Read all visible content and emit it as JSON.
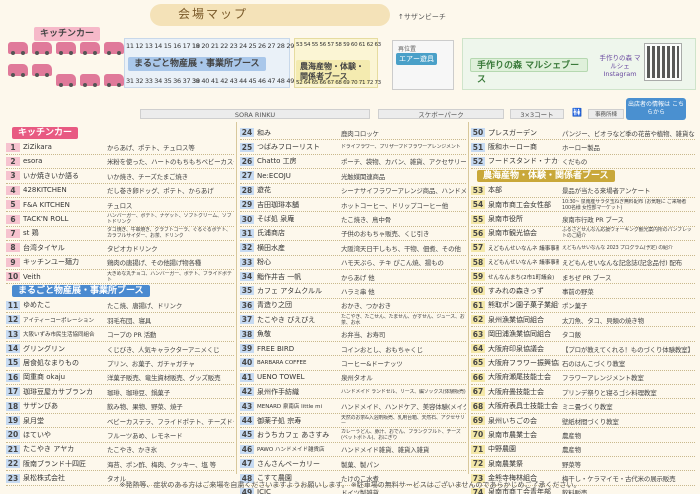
{
  "map": {
    "title": "会場マップ",
    "sunbeach": "↑サザンビーチ",
    "kitchen_banner": "キッチンカー",
    "marugoto_banner": "まるごと物産展・事業所ブース",
    "nogyo_banner": "農海産物・体験・関係者ブース",
    "tezukuri_banner": "手作りの森 マルシェブース",
    "play_label": "再位置",
    "play_air": "エアー遊具",
    "instagram": "手作りの森 マルシェ Instagram",
    "info_bubble": "出店者の情報は こちらから",
    "road_sora": "SORA RINKU",
    "road_skate": "スケボーパーク",
    "road_3x3": "3×3コート",
    "road_office": "事務所棟",
    "numrow_top_left": "11 12 13 14 15 16 17 18",
    "numrow_top_mid": "19 20 21 22 23 24 25 26 27 28 29 30",
    "numrow_bot_left": "31 32 33 34 35 36 37 38",
    "numrow_bot_mid": "39 40 41 42 43 44 45 46 47 48 49 50 51",
    "numrow_top_right": "53 54 55 56 57 58 59 60 61 62 63",
    "numrow_bot_right": "52 64 65 66 67 68 69 70 71 72 73"
  },
  "sections": {
    "kitchen": "キッチンカー",
    "marugoto": "まるごと物産展・事業所ブース",
    "nogyo": "農海産物・体験・関係者ブース"
  },
  "col1": [
    {
      "n": "1",
      "name": "ZiZikara",
      "desc": "からあげ、ポテト、チュロス等"
    },
    {
      "n": "2",
      "name": "esora",
      "desc": "米粉を使った、ハートのもちもちベビーカステラ"
    },
    {
      "n": "3",
      "name": "いか焼きいか語る",
      "desc": "いか焼き、チーズたまご焼き"
    },
    {
      "n": "4",
      "name": "428KITCHEN",
      "desc": "だし巻き卵ドッグ、ポテト、からあげ"
    },
    {
      "n": "5",
      "name": "F&A KITCHEN",
      "desc": "チュロス"
    },
    {
      "n": "6",
      "name": "TACK'N ROLL",
      "desc": "ハンバーガー、ポテト、ナゲット、ソフトクリーム、ソフトドリンク"
    },
    {
      "n": "7",
      "name": "st 鶏",
      "desc": "タコ焼き、牛串焼き、クラフトコーラ、ぐるぐるポテト、カラフルサイダー、お茶、ドリンク"
    },
    {
      "n": "8",
      "name": "台湾タイヤル",
      "desc": "タピオカドリンク"
    },
    {
      "n": "9",
      "name": "キッチンユー麺力",
      "desc": "鶏肉の唐揚げ、その他揚げ物各種"
    },
    {
      "n": "10",
      "name": "Veith",
      "desc": "大きめな丸チョコ、ハンバーガー、ポテト、フライドポテト"
    },
    {
      "n": "11",
      "name": "ゆめたこ",
      "desc": "たこ焼、唐揚げ、ドリンク"
    },
    {
      "n": "12",
      "name": "アイティーコーポレーション",
      "desc": "羽毛布団、寝具"
    },
    {
      "n": "13",
      "name": "大阪いずみ市民生活協同組合",
      "desc": "コープの PR 活動"
    },
    {
      "n": "14",
      "name": "グリングリン",
      "desc": "くじびき、人気キャラクターアニメくじ"
    },
    {
      "n": "15",
      "name": "居食処なまりもの",
      "desc": "プリン、お菓子、ガチャガチャ"
    },
    {
      "n": "16",
      "name": "岡重商 okaju",
      "desc": "洋菓子販売、竜生資材販売、グッズ販売"
    },
    {
      "n": "17",
      "name": "珈琲豆屋カサブランカ",
      "desc": "珈琲、珈琲豆、鍋菓子"
    },
    {
      "n": "18",
      "name": "サザンびあ",
      "desc": "飲み物、果物、野菜、焼子"
    },
    {
      "n": "19",
      "name": "泉月堂",
      "desc": "ベビーカステラ、フライドポテト、チーズドッグ"
    },
    {
      "n": "20",
      "name": "ほていや",
      "desc": "フルーツあめ、レモネード"
    },
    {
      "n": "21",
      "name": "たこやき アヤカ",
      "desc": "たこやき、かき氷"
    },
    {
      "n": "22",
      "name": "阪南ブランド十四匠",
      "desc": "海苔、ポン酢、梅肉、クッキー、塩 等"
    },
    {
      "n": "23",
      "name": "泉松株式会社",
      "desc": "タオル"
    }
  ],
  "col2": [
    {
      "n": "24",
      "name": "和み",
      "desc": "鹿肉コロッケ"
    },
    {
      "n": "25",
      "name": "つばみフローリスト",
      "desc": "ドライフラワー、プリザーブドフラワーアレンジメント"
    },
    {
      "n": "26",
      "name": "Chatto 工房",
      "desc": "ポーチ、袋物、カバン、雑貨、アクセサリー"
    },
    {
      "n": "27",
      "name": "Ne:ECOJU",
      "desc": "光触媒関連商品"
    },
    {
      "n": "28",
      "name": "遊花",
      "desc": "シーナサイフラワーアレンジ商品、ハンドメイド雑貨"
    },
    {
      "n": "29",
      "name": "吉田珈琲本舗",
      "desc": "ホットコーヒー、ドリップコーヒー他"
    },
    {
      "n": "30",
      "name": "そば処 泉庵",
      "desc": "たこ焼き、鳥中骨"
    },
    {
      "n": "31",
      "name": "氏浦商店",
      "desc": "子供のおもちゃ販売、くじ引き"
    },
    {
      "n": "32",
      "name": "横田水産",
      "desc": "大阪湾天日干しもち、干物、佃煮、その他"
    },
    {
      "n": "33",
      "name": "粉心",
      "desc": "ハモ天ぷら、チキ ぴこん焼、揚もの"
    },
    {
      "n": "34",
      "name": "鮨作井吉 一帆",
      "desc": "からあげ 他"
    },
    {
      "n": "35",
      "name": "カフェ アタムクルル",
      "desc": "ハラミ串 他"
    },
    {
      "n": "36",
      "name": "青造り之団",
      "desc": "おかき、つかおき"
    },
    {
      "n": "37",
      "name": "たこやき ぴえぴえ",
      "desc": "たこやき、たこせん、たません、かすせん、ジュース、お茶、お水"
    },
    {
      "n": "38",
      "name": "魚敬",
      "desc": "お弁当、お寿司"
    },
    {
      "n": "39",
      "name": "FREE BIRD",
      "desc": "コインおとし、おもちゃくじ"
    },
    {
      "n": "40",
      "name": "BARBARA COFFEE",
      "desc": "コーヒー&ドーナッツ"
    },
    {
      "n": "41",
      "name": "UENO TOWEL",
      "desc": "泉州タオル"
    },
    {
      "n": "42",
      "name": "泉州作手紡織",
      "desc": "ハンドメイド ランドセル、リース、編ソックス(体験販売)"
    },
    {
      "n": "43",
      "name": "MENARD 泉南店 little mi",
      "desc": "ハンドメイド、ハンドケア、美容体験(メイク)"
    },
    {
      "n": "44",
      "name": "御薬子処 宗寿",
      "desc": "天然のお茶&入浴剤販売、乳用台箱、天然石、アクセサリー"
    },
    {
      "n": "45",
      "name": "おうちカフェ あさすみ",
      "desc": "カレーうどん、豚汁、おでん、フランクフルト、チーズ(ベットボトル)、おにぎり"
    },
    {
      "n": "46",
      "name": "PAWO ハンドメイド雑貨店",
      "desc": "ハンドメイド雑貨、雑貨入雑貨"
    },
    {
      "n": "47",
      "name": "さんさんベーカリー",
      "desc": "製菓、製パン"
    },
    {
      "n": "48",
      "name": "こすて農園",
      "desc": "たけのこ水煮"
    },
    {
      "n": "49",
      "name": "ICIC",
      "desc": "ドイツ製雑貨"
    }
  ],
  "col3": [
    {
      "n": "50",
      "name": "プレスガーデン",
      "desc": "パンジー、ビオラなど季の花苗や植物、雑貨など"
    },
    {
      "n": "51",
      "name": "阪和ホーロー商",
      "desc": "ホーロー製品"
    },
    {
      "n": "52",
      "name": "フードスタンド・ナカタ",
      "desc": "くだもの"
    },
    {
      "n": "53",
      "name": "本部",
      "desc": "景品が当たる来場者アンケート"
    },
    {
      "n": "54",
      "name": "泉南市商工会女性部",
      "desc": "10:30~ 泉南産サラダ玉ねぎ無料配布 (お気軽に ご来場者100名様 女性部マーケット)"
    },
    {
      "n": "55",
      "name": "泉南市役所",
      "desc": "泉南市行政 PR ブース"
    },
    {
      "n": "56",
      "name": "泉南市観光協会",
      "desc": "ふるさとせんなん応援ウォーキング観光案内所のパンフレットのご紹介"
    },
    {
      "n": "57",
      "name": "えどもんせいなんネ 議事事務局",
      "desc": "えどもんせいなんな 2023 プログラム(予定) の紹介"
    },
    {
      "n": "58",
      "name": "えどもんせいなんネ 議事事務局",
      "desc": "えどもんせいなんな記念誌(記念品付) 配布"
    },
    {
      "n": "59",
      "name": "せんなんまち(2市1町議会)",
      "desc": "まちぜ PR ブース"
    },
    {
      "n": "60",
      "name": "すみれの森きっず",
      "desc": "事前の野菜"
    },
    {
      "n": "61",
      "name": "熊取ポン園子菓子業組合",
      "desc": "ポン菓子"
    },
    {
      "n": "62",
      "name": "泉州漁業協同組合",
      "desc": "太刀魚、タコ、貝類の焼き物"
    },
    {
      "n": "63",
      "name": "岡田浦漁業協同組合",
      "desc": "タコ飯"
    },
    {
      "n": "64",
      "name": "大阪府印泉協議会",
      "desc": "【プロが教えてくれる！ものづくり体験教室】"
    },
    {
      "n": "65",
      "name": "大阪府フラワー振興協議会",
      "desc": "石のはんこづくり教室"
    },
    {
      "n": "66",
      "name": "大阪府瀬尾技能士会",
      "desc": "フラワーアレンジメント教室"
    },
    {
      "n": "67",
      "name": "大阪府畳技能士会",
      "desc": "プリンデ祭りと寝るゴシ料理教室"
    },
    {
      "n": "68",
      "name": "大阪府表具士技能士会",
      "desc": "ミニ畳づくり教室"
    },
    {
      "n": "69",
      "name": "泉州いちごの会",
      "desc": "壁紙材間づくり教室"
    },
    {
      "n": "70",
      "name": "泉南市農業士会",
      "desc": "農産物"
    },
    {
      "n": "71",
      "name": "中野農園",
      "desc": "農産物"
    },
    {
      "n": "72",
      "name": "泉南農業祭",
      "desc": "野菜等"
    },
    {
      "n": "73",
      "name": "金熊寺梅林組合",
      "desc": "梅干し・ケラマイモ・古代米の展示販売"
    },
    {
      "n": "74",
      "name": "泉南市商工会青年部",
      "desc": "飲料販売"
    }
  ],
  "footer": "※発熱等、症状のある方はご来場を自粛くださいますようお願いします。 ※駐車場の無料サービスはございませんのであらかじめご了承ください。"
}
